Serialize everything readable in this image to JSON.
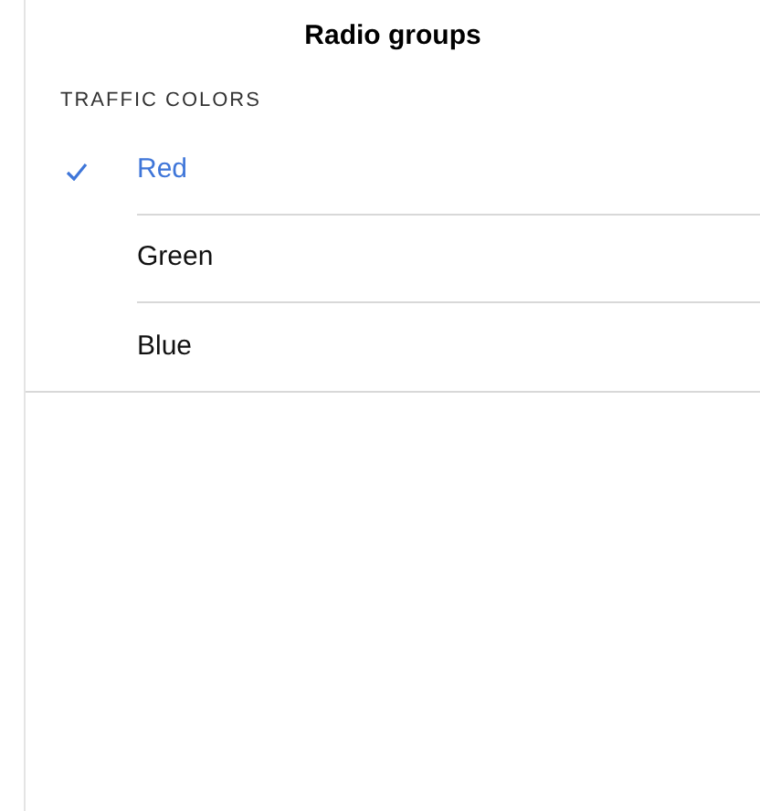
{
  "title": "Radio groups",
  "section": {
    "header": "TRAFFIC COLORS",
    "options": [
      {
        "label": "Red",
        "selected": true
      },
      {
        "label": "Green",
        "selected": false
      },
      {
        "label": "Blue",
        "selected": false
      }
    ]
  }
}
